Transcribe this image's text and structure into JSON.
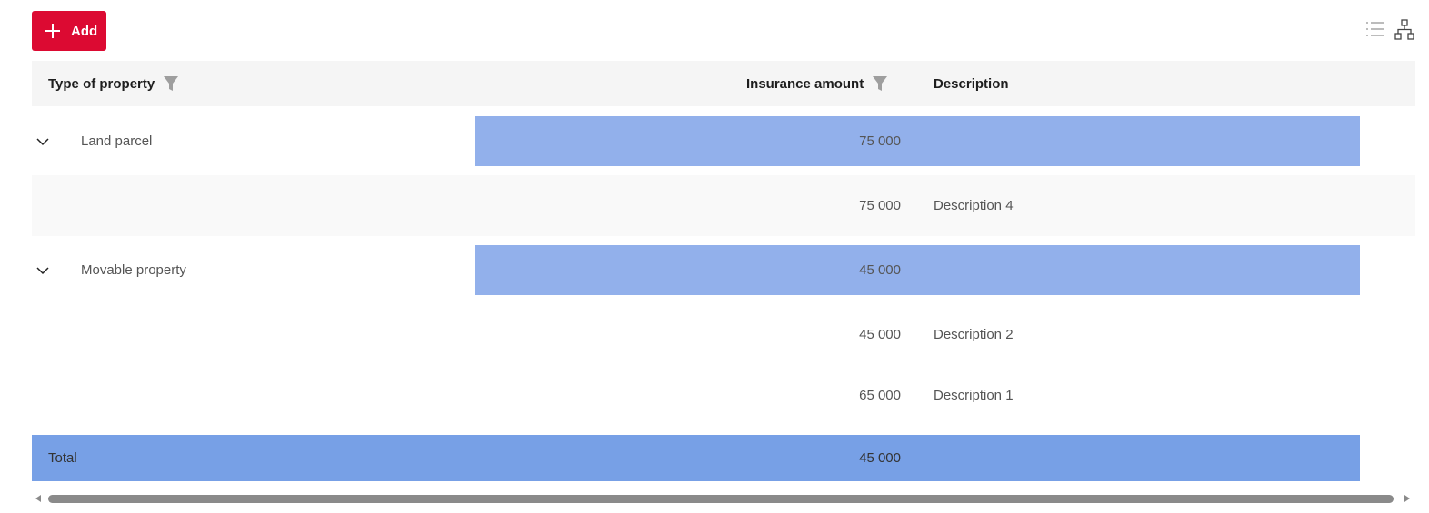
{
  "toolbar": {
    "add_label": "Add",
    "add_color": "#dc0a32",
    "list_view_icon": "list-icon",
    "tree_view_icon": "hierarchy-icon"
  },
  "grid": {
    "columns": [
      {
        "label": "Type of property",
        "filter": true
      },
      {
        "label": "Insurance amount",
        "filter": true
      },
      {
        "label": "Description",
        "filter": false
      }
    ],
    "rows": [
      {
        "kind": "group",
        "type": "Land parcel",
        "amount": "75 000",
        "description": ""
      },
      {
        "kind": "item",
        "type": "",
        "amount": "75 000",
        "description": "Description 4"
      },
      {
        "kind": "group",
        "type": "Movable property",
        "amount": "45 000",
        "description": ""
      },
      {
        "kind": "item",
        "type": "",
        "amount": "45 000",
        "description": "Description 2"
      },
      {
        "kind": "item",
        "type": "",
        "amount": "65 000",
        "description": "Description 1"
      }
    ],
    "total": {
      "label": "Total",
      "amount": "45 000"
    },
    "highlight_color": "#92b0eb",
    "total_color": "#77a0e6"
  }
}
